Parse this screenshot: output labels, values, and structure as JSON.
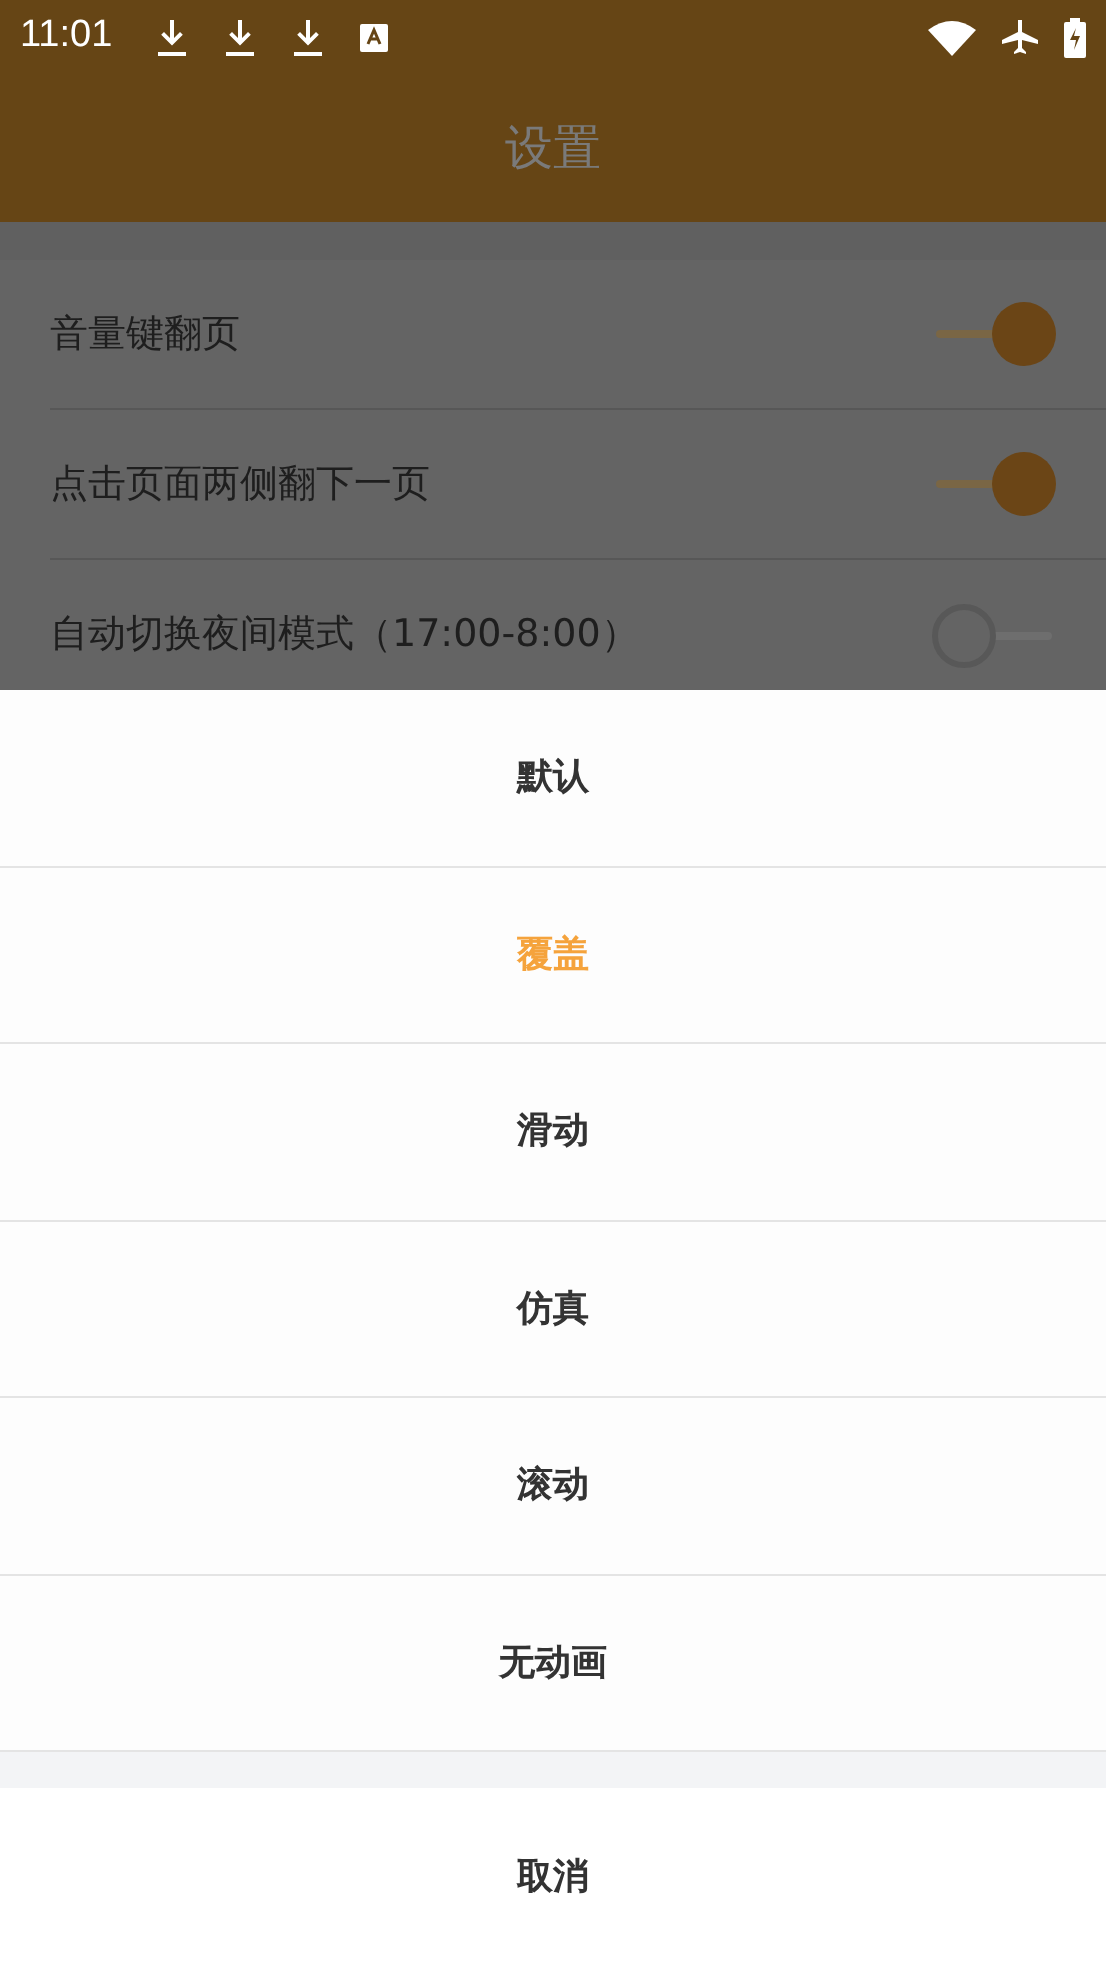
{
  "status_bar": {
    "time": "11:01"
  },
  "app_bar": {
    "title": "设置"
  },
  "settings": [
    {
      "label": "音量键翻页",
      "on": true
    },
    {
      "label": "点击页面两侧翻下一页",
      "on": true
    },
    {
      "label": "自动切换夜间模式（17:00-8:00）",
      "on": false
    }
  ],
  "sheet": {
    "options": [
      {
        "label": "默认",
        "selected": false
      },
      {
        "label": "覆盖",
        "selected": true
      },
      {
        "label": "滑动",
        "selected": false
      },
      {
        "label": "仿真",
        "selected": false
      },
      {
        "label": "滚动",
        "selected": false
      },
      {
        "label": "无动画",
        "selected": false
      }
    ],
    "cancel": "取消"
  }
}
